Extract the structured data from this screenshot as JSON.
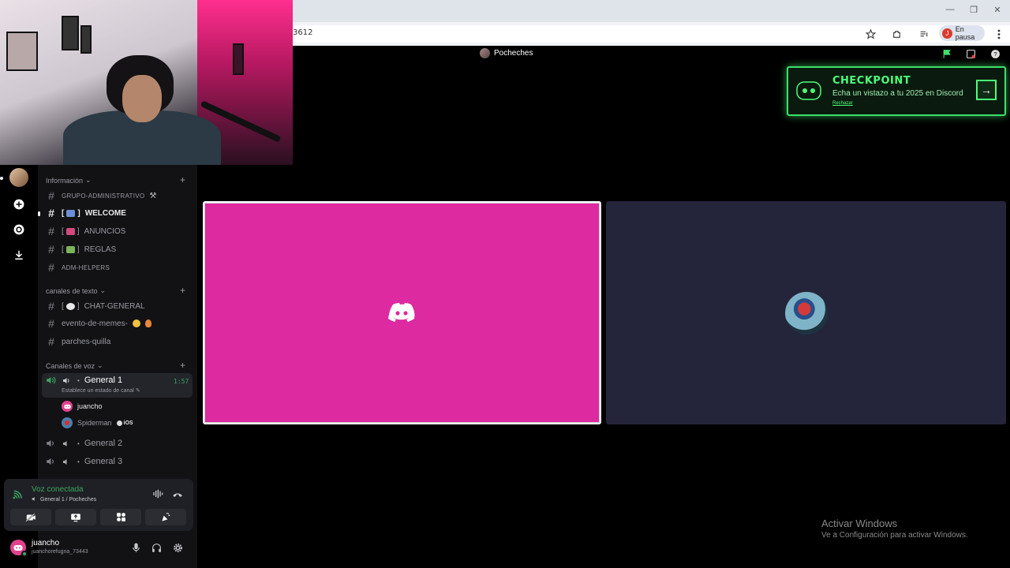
{
  "browser": {
    "url_fragment": "3612",
    "profile_initial": "J",
    "profile_label": "En pausa"
  },
  "server": {
    "name": "Pocheches"
  },
  "checkpoint": {
    "title": "CHECKPOINT",
    "subtitle": "Echa un vistazo a tu 2025 en Discord",
    "dismiss": "Rechazar"
  },
  "channels": {
    "info_category": "Información",
    "info_items": [
      {
        "label": "GRUPO-ADMINISTRATIVO",
        "emoji": "⚒"
      },
      {
        "label": "WELCOME"
      },
      {
        "label": "ANUNCIOS"
      },
      {
        "label": "REGLAS"
      },
      {
        "label": "ADM-HELPERS"
      }
    ],
    "text_category": "canales de texto",
    "text_items": [
      {
        "label": "CHAT-GENERAL"
      },
      {
        "label": "evento-de-memes-"
      },
      {
        "label": "parches-quilla"
      }
    ],
    "voice_category": "Canales de voz",
    "voice_items": [
      {
        "label": "General 1",
        "time": "1:57",
        "status": "Establece un estado de canal"
      },
      {
        "label": "General 2"
      },
      {
        "label": "General 3"
      }
    ],
    "members": [
      {
        "name": "juancho"
      },
      {
        "name": "Spiderman",
        "badge": "iOS"
      }
    ]
  },
  "voice_panel": {
    "title": "Voz conectada",
    "subtitle": "General 1 / Pocheches"
  },
  "user": {
    "name": "juancho",
    "tag": "juanchorefugna_73443"
  },
  "watermark": {
    "title": "Activar Windows",
    "subtitle": "Ve a Configuración para activar Windows."
  },
  "colors": {
    "accent_green": "#3ba55d",
    "tile_pink": "#dd2aa0",
    "tile_dark": "#24253a",
    "checkpoint_green": "#4cff7a"
  }
}
